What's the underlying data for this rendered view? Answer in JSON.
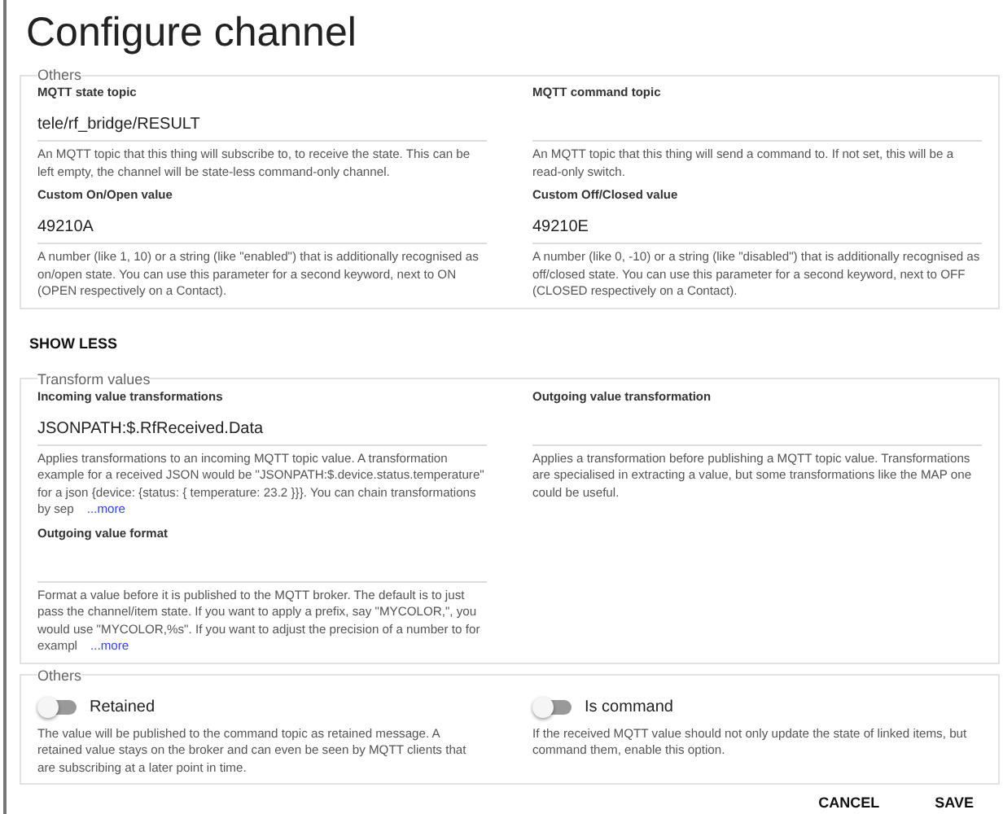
{
  "title": "Configure channel",
  "sections": [
    {
      "legend": "Others",
      "items": [
        {
          "kind": "text",
          "label": "MQTT state topic",
          "value": "tele/rf_bridge/RESULT",
          "description": "An MQTT topic that this thing will subscribe to, to receive the state. This can be left empty, the channel will be state-less command-only channel."
        },
        {
          "kind": "text",
          "label": "MQTT command topic",
          "description": "An MQTT topic that this thing will send a command to. If not set, this will be a read-only switch."
        },
        {
          "kind": "text",
          "label": "Custom On/Open value",
          "value": "49210A",
          "description": "A number (like 1, 10) or a string (like \"enabled\") that is additionally recognised as on/open state. You can use this parameter for a second keyword, next to ON (OPEN respectively on a Contact)."
        },
        {
          "kind": "text",
          "label": "Custom Off/Closed value",
          "value": "49210E",
          "description": "A number (like 0, -10) or a string (like \"disabled\") that is additionally recognised as off/closed state. You can use this parameter for a second keyword, next to OFF (CLOSED respectively on a Contact)."
        }
      ]
    },
    {
      "legend": "Transform values",
      "items": [
        {
          "kind": "text",
          "label": "Incoming value transformations",
          "value": "JSONPATH:$.RfReceived.Data",
          "description": "Applies transformations to an incoming MQTT topic value. A transformation example for a received JSON would be \"JSONPATH:$.device.status.temperature\" for a json {device: {status: { temperature: 23.2 }}}. You can chain transformations by sep",
          "more": "...more"
        },
        {
          "kind": "text",
          "label": "Outgoing value transformation",
          "description": "Applies a transformation before publishing a MQTT topic value. Transformations are specialised in extracting a value, but some transformations like the MAP one could be useful."
        },
        {
          "kind": "text",
          "label": "Outgoing value format",
          "description": "Format a value before it is published to the MQTT broker. The default is to just pass the channel/item state. If you want to apply a prefix, say \"MYCOLOR,\", you would use \"MYCOLOR,%s\". If you want to adjust the precision of a number to for exampl",
          "more": "...more"
        }
      ]
    },
    {
      "legend": "Others",
      "items": [
        {
          "kind": "toggle",
          "label": "Retained",
          "on": false,
          "description": "The value will be published to the command topic as retained message. A retained value stays on the broker and can even be seen by MQTT clients that are subscribing at a later point in time."
        },
        {
          "kind": "toggle",
          "label": "Is command",
          "on": false,
          "description": "If the received MQTT value should not only update the state of linked items, but command them, enable this option."
        }
      ]
    }
  ],
  "show_less": "SHOW LESS",
  "buttons": [
    "CANCEL",
    "SAVE"
  ]
}
